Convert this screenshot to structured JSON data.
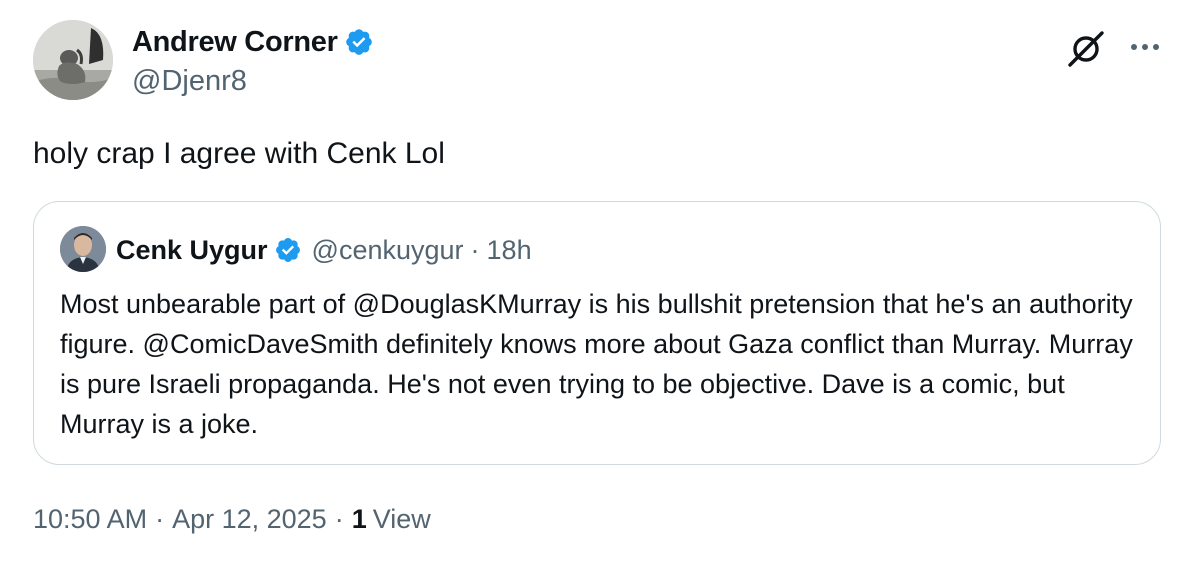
{
  "author": {
    "name": "Andrew Corner",
    "handle": "@Djenr8",
    "verified": true
  },
  "tweet": {
    "text": "holy crap I agree with Cenk Lol"
  },
  "quoted_tweet": {
    "name": "Cenk Uygur",
    "handle": "@cenkuygur",
    "separator": "·",
    "time": "18h",
    "verified": true,
    "text": "Most unbearable part of @DouglasKMurray is his bullshit pretension that he's an authority figure. @ComicDaveSmith definitely knows more about Gaza conflict than Murray. Murray is pure Israeli propaganda. He's not even trying to be objective. Dave is a comic, but Murray is a joke."
  },
  "meta": {
    "time": "10:50 AM",
    "separator": "·",
    "date": "Apr 12, 2025",
    "views_count": "1",
    "views_label": "View"
  },
  "icons": {
    "grok": "grok-icon",
    "more": "more-icon",
    "verified": "verified-badge-icon"
  },
  "colors": {
    "verified_blue": "#1d9bf0",
    "text_primary": "#0f1419",
    "text_secondary": "#536471",
    "border": "#cfd9de"
  }
}
